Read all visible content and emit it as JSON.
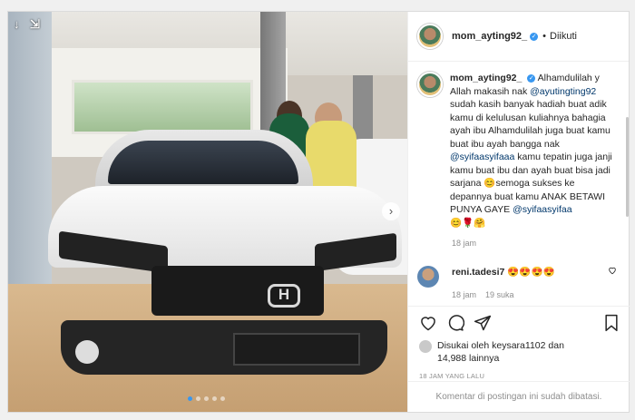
{
  "post": {
    "username": "mom_ayting92_",
    "follow_status": "Diikuti",
    "verified_icon": "verified-badge-icon",
    "carousel_dots": 5,
    "carousel_active_index": 0,
    "car_logo": "H"
  },
  "caption": {
    "username": "mom_ayting92_",
    "text_1": "Alhamdulilah y Allah makasih nak",
    "mention_1": "@ayutingting92",
    "text_2": "sudah kasih banyak hadiah buat adik kamu di kelulusan kuliahnya bahagia ayah ibu Alhamdulilah juga buat kamu buat ibu ayah bangga nak",
    "mention_2": "@syifaasyifaaa",
    "text_3": "kamu tepatin juga janji kamu buat ibu dan ayah buat bisa jadi sarjana",
    "emoji_1": "😊",
    "text_4": "semoga sukses ke depannya buat kamu ANAK BETAWI PUNYA GAYE",
    "mention_3": "@syifaasyifaa",
    "emoji_line": "😊🌹🤗",
    "time": "18 jam"
  },
  "comment": {
    "username": "reni.tadesi7",
    "text": "😍😍😍😍",
    "time": "18 jam",
    "likes": "19 suka"
  },
  "likes": {
    "prefix": "Disukai oleh",
    "user": "keysara1102",
    "conjunction": "dan",
    "count": "14,988 lainnya"
  },
  "timestamp": "18 JAM YANG LALU",
  "footer": "Komentar di postingan ini sudah dibatasi.",
  "icons": {
    "arrow_down": "↓",
    "arrows_shrink": "⇲",
    "next": "›",
    "verified": "✓",
    "dot": "•"
  }
}
